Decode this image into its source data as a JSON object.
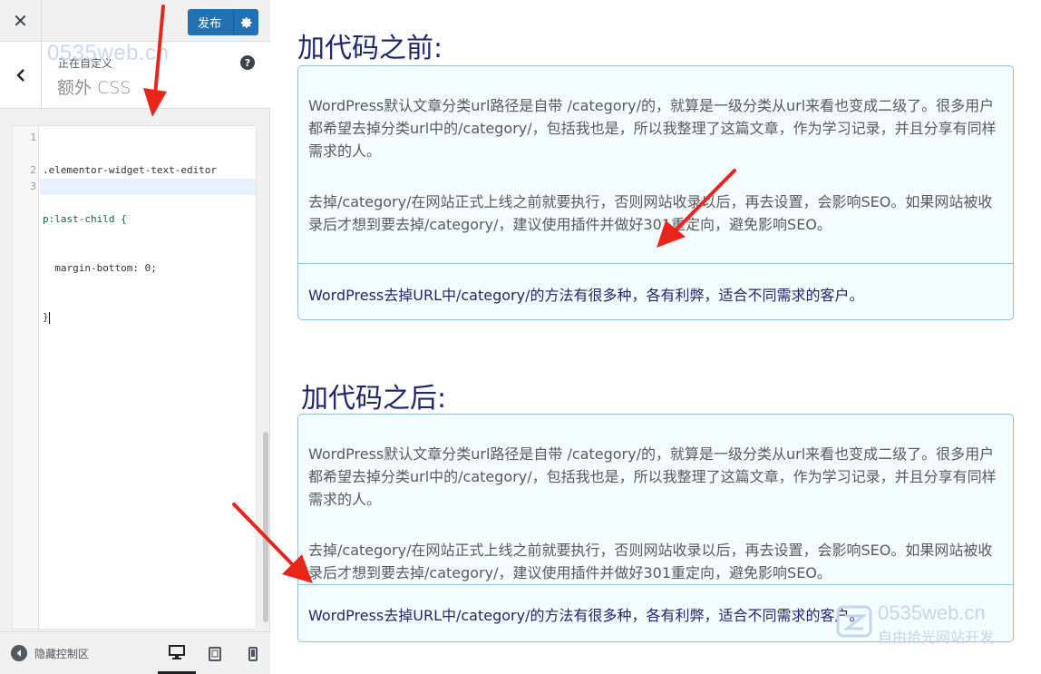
{
  "topbar": {
    "close_glyph": "✕",
    "publish_label": "发布",
    "publish_settings_icon": "gear-icon"
  },
  "section": {
    "breadcrumb": "正在自定义",
    "title": "额外 CSS",
    "help_glyph": "?"
  },
  "watermark_top": "0535web.cn",
  "editor": {
    "line_numbers": [
      "1",
      "",
      "2",
      "3"
    ],
    "lines": [
      ".elementor-widget-text-editor",
      "p:last-child {",
      "  margin-bottom: 0;",
      "}"
    ]
  },
  "footer": {
    "collapse_label": "隐藏控制区"
  },
  "preview": {
    "before_heading": "加代码之前:",
    "after_heading": "加代码之后:",
    "para1": "WordPress默认文章分类url路径是自带 /category/的，就算是一级分类从url来看也变成二级了。很多用户都希望去掉分类url中的/category/，包括我也是，所以我整理了这篇文章，作为学习记录，并且分享有同样需求的人。",
    "para2": "去掉/category/在网站正式上线之前就要执行，否则网站收录以后，再去设置，会影响SEO。如果网站被收录后才想到要去掉/category/，建议使用插件并做好301重定向，避免影响SEO。",
    "footer_line": "WordPress去掉URL中/category/的方法有很多种，各有利弊，适合不同需求的客户。"
  },
  "watermark_br": {
    "line1": "0535web.cn",
    "line2": "自由拾光网站开发"
  },
  "colors": {
    "accent": "#2271b1",
    "heading": "#20276b",
    "box_border": "#93c2d9",
    "box_bg": "#f3fdfe",
    "arrow": "#e8251b"
  }
}
